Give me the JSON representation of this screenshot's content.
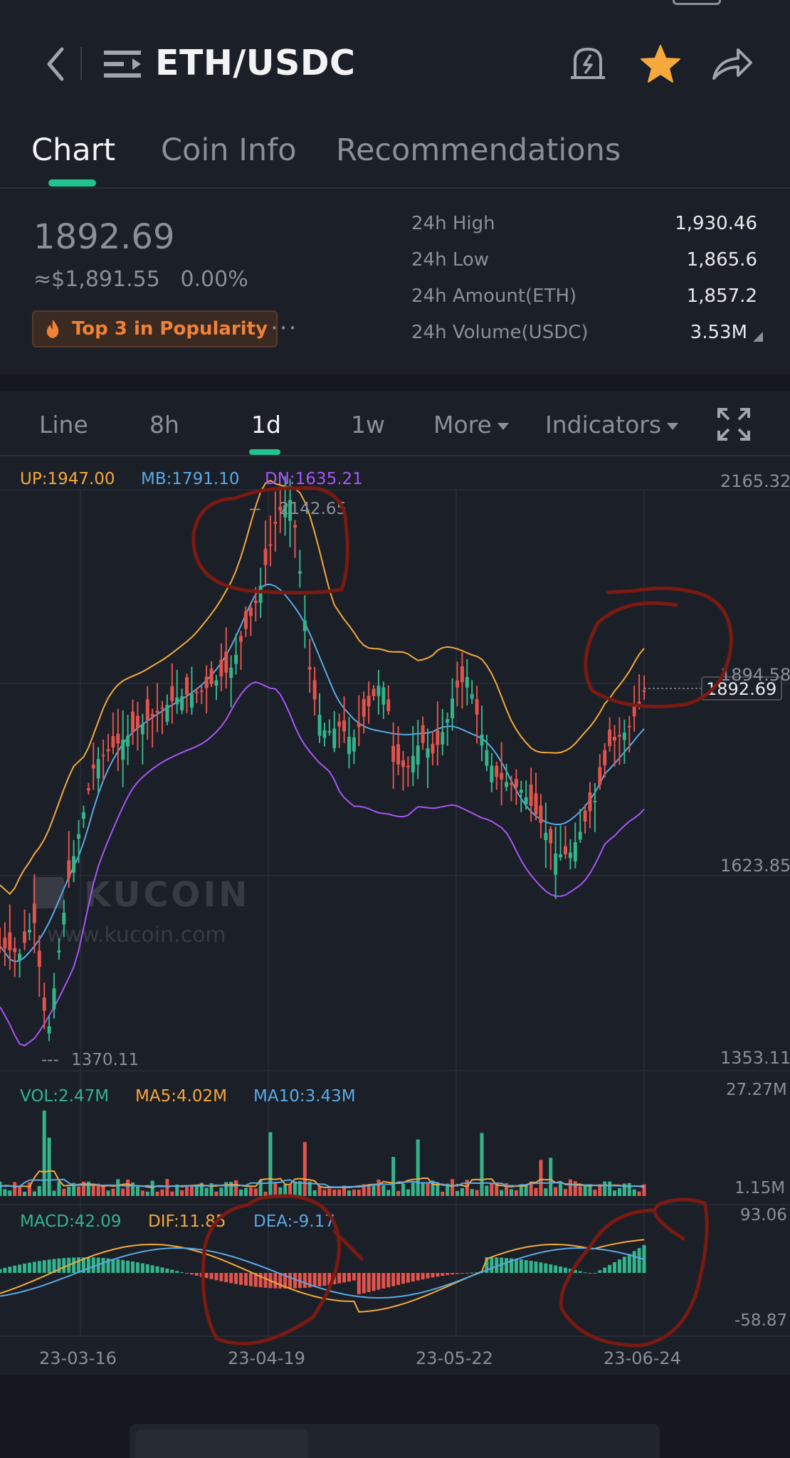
{
  "header": {
    "pair": "ETH/USDC",
    "icons": [
      "back-chevron-icon",
      "menu-list-icon",
      "price-alert-bell-icon",
      "favorite-star-icon",
      "share-arrow-icon"
    ]
  },
  "tabs": [
    {
      "label": "Chart",
      "active": true
    },
    {
      "label": "Coin Info",
      "active": false
    },
    {
      "label": "Recommendations",
      "active": false
    }
  ],
  "summary": {
    "last_price": "1892.69",
    "fiat_price": "≈$1,891.55",
    "change": "0.00%",
    "badge": "Top 3 in Popularity",
    "more": "···",
    "stats": [
      {
        "label": "24h High",
        "value": "1,930.46"
      },
      {
        "label": "24h Low",
        "value": "1,865.6"
      },
      {
        "label": "24h Amount(ETH)",
        "value": "1,857.2"
      },
      {
        "label": "24h Volume(USDC)",
        "value": "3.53M"
      }
    ]
  },
  "chart_controls": {
    "items": [
      {
        "label": "Line",
        "active": false
      },
      {
        "label": "8h",
        "active": false
      },
      {
        "label": "1d",
        "active": true
      },
      {
        "label": "1w",
        "active": false
      },
      {
        "label": "More",
        "active": false,
        "dropdown": true
      },
      {
        "label": "Indicators",
        "active": false,
        "dropdown": true
      }
    ],
    "fullscreen_icon": "fullscreen-expand-icon"
  },
  "chart_data": {
    "type": "candlestick",
    "pair": "ETH/USDC",
    "interval": "1d",
    "overlays": {
      "boll": [
        {
          "label": "UP:1947.00",
          "color": "#f5a83b"
        },
        {
          "label": "MB:1791.10",
          "color": "#5aa9e6"
        },
        {
          "label": "DN:1635.21",
          "color": "#a855f7"
        }
      ]
    },
    "price_axis_labels": [
      "2165.32",
      "1894.58",
      "1623.85",
      "1353.11"
    ],
    "price_range": [
      1353.11,
      2165.32
    ],
    "current_price": "1892.69",
    "max_marker": "2142.65",
    "min_marker": "1370.11",
    "x_tick_labels": [
      "23-03-16",
      "23-04-19",
      "23-05-22",
      "23-06-24"
    ],
    "watermark": {
      "brand": "KUCOIN",
      "url": "www.kucoin.com"
    },
    "volume": {
      "labels": [
        {
          "text": "VOL:2.47M",
          "color": "#34b48b"
        },
        {
          "text": "MA5:4.02M",
          "color": "#f5a83b"
        },
        {
          "text": "MA10:3.43M",
          "color": "#5aa9e6"
        }
      ],
      "axis_labels": [
        "27.27M",
        "1.15M"
      ]
    },
    "macd": {
      "labels": [
        {
          "text": "MACD:42.09",
          "color": "#34b48b"
        },
        {
          "text": "DIF:11.85",
          "color": "#f5a83b"
        },
        {
          "text": "DEA:-9.17",
          "color": "#5aa9e6"
        }
      ],
      "axis_labels": [
        "93.06",
        "-58.87"
      ]
    },
    "colors": {
      "up": "#34b48b",
      "down": "#e2534c",
      "grid": "#2b2f38",
      "annotation": "#7a1a12"
    }
  }
}
